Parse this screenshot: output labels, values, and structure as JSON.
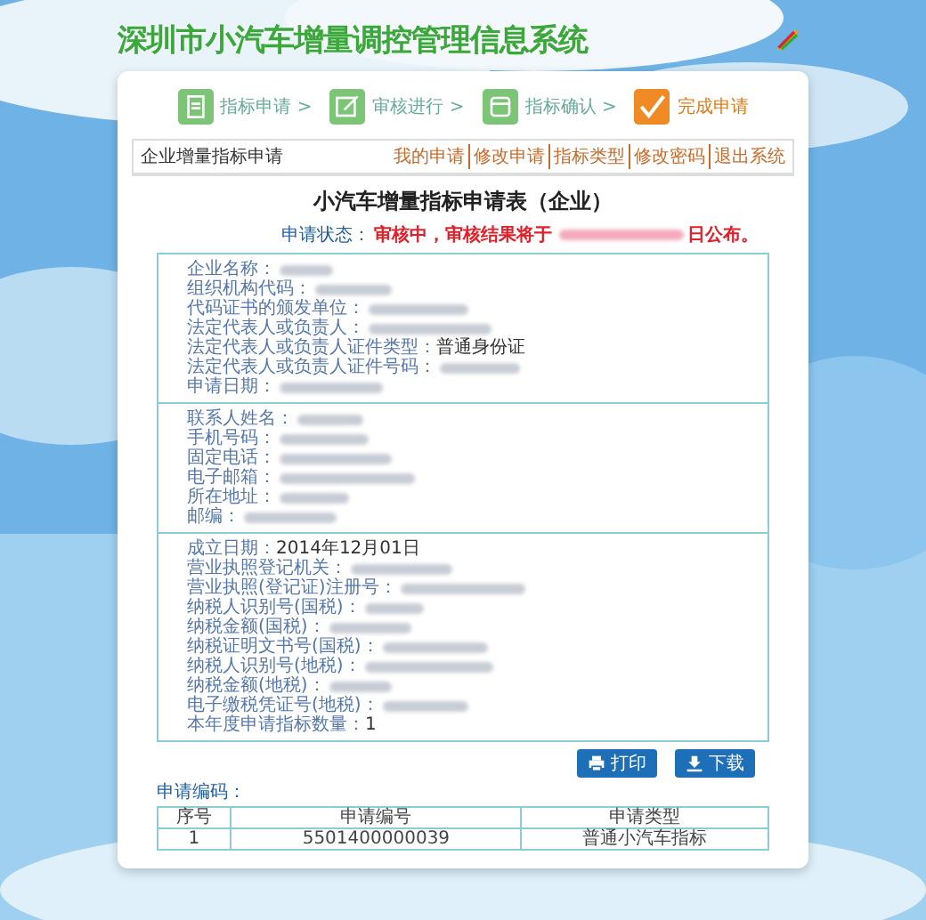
{
  "site_title": "深圳市小汽车增量调控管理信息系统",
  "steps": [
    {
      "label": "指标申请 >",
      "selected": false
    },
    {
      "label": "审核进行 >",
      "selected": false
    },
    {
      "label": "指标确认 >",
      "selected": false
    },
    {
      "label": "完成申请",
      "selected": true
    }
  ],
  "section_header": {
    "title": "企业增量指标申请",
    "links": [
      "我的申请",
      "修改申请",
      "指标类型",
      "修改密码",
      "退出系统"
    ]
  },
  "form": {
    "title": "小汽车增量指标申请表（企业）",
    "status_label": "申请状态：",
    "status_text": "审核中，审核结果将于",
    "status_tail": "日公布。"
  },
  "sections": [
    {
      "fields": [
        {
          "label": "企业名称：",
          "redacted": true
        },
        {
          "label": "组织机构代码：",
          "redacted": true
        },
        {
          "label": "代码证书的颁发单位：",
          "redacted": true
        },
        {
          "label": "法定代表人或负责人：",
          "redacted": true
        },
        {
          "label": "法定代表人或负责人证件类型：",
          "value": "普通身份证",
          "redacted": false
        },
        {
          "label": "法定代表人或负责人证件号码：",
          "redacted": true
        },
        {
          "label": "申请日期：",
          "redacted": true
        }
      ]
    },
    {
      "fields": [
        {
          "label": "联系人姓名：",
          "redacted": true
        },
        {
          "label": "手机号码：",
          "redacted": true
        },
        {
          "label": "固定电话：",
          "redacted": true
        },
        {
          "label": "电子邮箱：",
          "redacted": true
        },
        {
          "label": "所在地址：",
          "redacted": true
        },
        {
          "label": "邮编：",
          "redacted": true
        }
      ]
    },
    {
      "fields": [
        {
          "label": "成立日期：",
          "value": "2014年12月01日",
          "redacted": false
        },
        {
          "label": "营业执照登记机关：",
          "redacted": true
        },
        {
          "label": "营业执照(登记证)注册号：",
          "redacted": true
        },
        {
          "label": "纳税人识别号(国税)：",
          "redacted": true
        },
        {
          "label": "纳税金额(国税)：",
          "redacted": true
        },
        {
          "label": "纳税证明文书号(国税)：",
          "redacted": true
        },
        {
          "label": "纳税人识别号(地税)：",
          "redacted": true
        },
        {
          "label": "纳税金额(地税)：",
          "redacted": true
        },
        {
          "label": "电子缴税凭证号(地税)：",
          "redacted": true
        },
        {
          "label": "本年度申请指标数量：",
          "value": "1",
          "redacted": false
        }
      ]
    }
  ],
  "buttons": [
    {
      "label": "打印",
      "kind": "print"
    },
    {
      "label": "下载",
      "kind": "download"
    }
  ],
  "codes": {
    "label": "申请编码：",
    "columns": [
      "序号",
      "申请编号",
      "申请类型"
    ],
    "rows": [
      [
        "1",
        "5501400000039",
        "普通小汽车指标"
      ]
    ]
  }
}
